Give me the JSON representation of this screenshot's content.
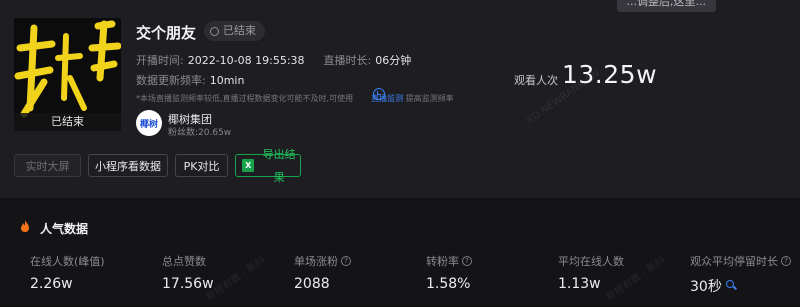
{
  "toast": {
    "text": "...调整后,这里..."
  },
  "cover": {
    "badge": "已结束"
  },
  "live": {
    "title": "交个朋友",
    "status": "已结束",
    "start_label": "开播时间:",
    "start_value": "2022-10-08 19:55:38",
    "duration_label": "直播时长:",
    "duration_value": "06分钟",
    "refresh_label": "数据更新频率:",
    "refresh_value": "10min",
    "notice_text": "*本场直播监测频率较低,直播过程数据变化可能不及时,可使用",
    "notice_link": "直播监测",
    "notice_tail": "提高监测频率"
  },
  "org": {
    "logo_text": "椰树",
    "name": "椰树集团",
    "fans_label": "粉丝数:",
    "fans_value": "20.65w"
  },
  "viewers": {
    "label": "观看人次",
    "value": "13.25w"
  },
  "watermarks": {
    "domain": "XD.NEWRANK.CN",
    "brand": "新榜有数 · 新抖"
  },
  "buttons": {
    "realtime": "实时大屏",
    "miniprogram": "小程序看数据",
    "pk": "PK对比",
    "export": "导出结果",
    "export_icon_text": "X"
  },
  "section": {
    "title": "人气数据"
  },
  "stats": [
    {
      "label": "在线人数(峰值)",
      "value": "2.26w",
      "help": false
    },
    {
      "label": "总点赞数",
      "value": "17.56w",
      "help": false
    },
    {
      "label": "单场涨粉",
      "value": "2088",
      "help": true
    },
    {
      "label": "转粉率",
      "value": "1.58%",
      "help": true
    },
    {
      "label": "平均在线人数",
      "value": "1.13w",
      "help": false
    },
    {
      "label": "观众平均停留时长",
      "value": "30秒",
      "help": true,
      "zoom": true
    }
  ],
  "colors": {
    "accent": "#3b82f6",
    "export": "#22c55e",
    "flame": "#f97316",
    "cover_stroke": "#f2d31b"
  }
}
